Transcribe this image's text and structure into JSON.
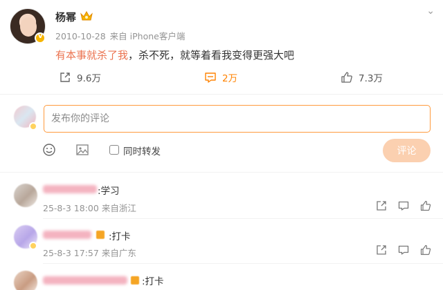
{
  "post": {
    "username": "杨幂",
    "meta_date": "2010-10-28",
    "meta_source": "来自 iPhone客户端",
    "text_highlight": "有本事就杀了我",
    "text_rest": "，杀不死，就等着看我变得更强大吧",
    "repost_count": "9.6万",
    "comment_count": "2万",
    "like_count": "7.3万",
    "icons": {
      "repost": "share-out-icon",
      "comment": "comment-bubble-icon",
      "like": "thumbs-up-icon",
      "crown": "crown-icon",
      "more": "chevron-down-icon"
    }
  },
  "composer": {
    "placeholder": "发布你的评论",
    "repost_checkbox_label": "同时转发",
    "submit_label": "评论",
    "icons": {
      "emoji": "emoji-icon",
      "image": "image-icon"
    }
  },
  "comments": [
    {
      "text": ":学习",
      "date": "25-8-3 18:00",
      "source": "来自浙江"
    },
    {
      "text": ":打卡",
      "date": "25-8-3 17:57",
      "source": "来自广东"
    },
    {
      "text": ":打卡",
      "date": "",
      "source": ""
    }
  ],
  "colors": {
    "accent": "#ff8200",
    "highlight_text": "#eb7350",
    "input_border": "#ff9a3c",
    "submit_bg": "#fbd0b0"
  }
}
